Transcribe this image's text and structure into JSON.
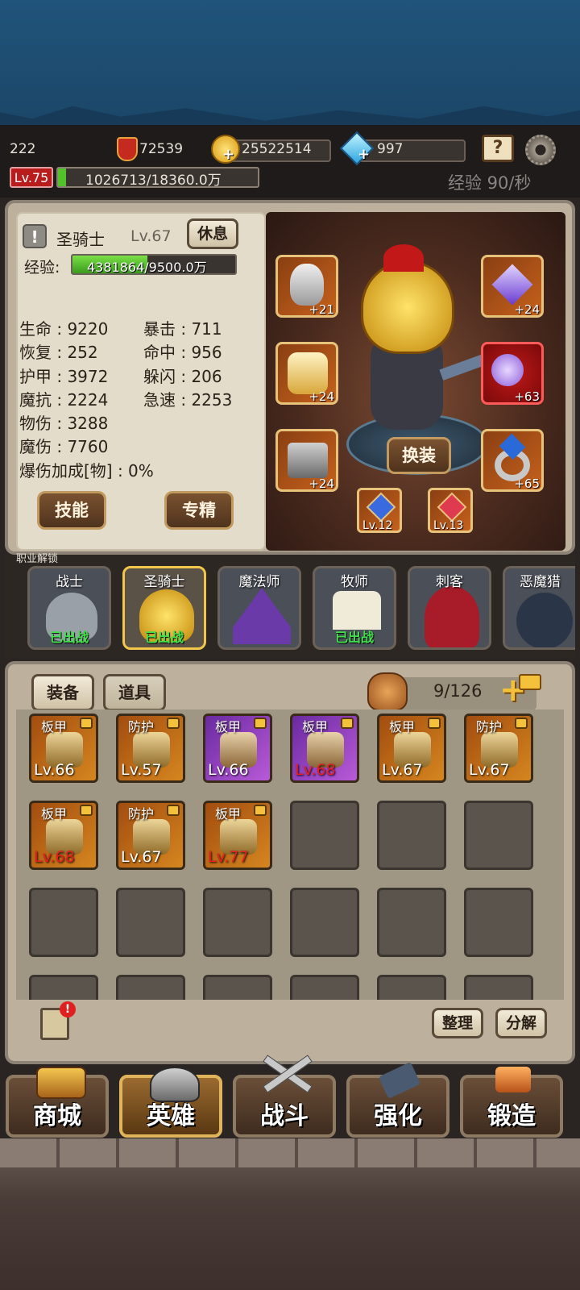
{
  "hud": {
    "player_id": "222",
    "power": "72539",
    "gold": "25522514",
    "gems": "997",
    "level": "Lv.75",
    "exp_bar": "1026713/18360.0万",
    "exp_rate": "经验 90/秒"
  },
  "hero": {
    "class_name": "圣骑士",
    "level": "Lv.67",
    "rest_label": "休息",
    "exp_label": "经验:",
    "exp_value": "4381864/9500.0万",
    "exp_fraction": 0.46,
    "stats_left": [
      "生命 : 9220",
      "恢复 : 252",
      "护甲 : 3972",
      "魔抗 : 2224",
      "物伤 : 3288",
      "魔伤 : 7760",
      "爆伤加成[物] : 0%"
    ],
    "stats_right": [
      "暴击 : 711",
      "命中 : 956",
      "躲闪 : 206",
      "急速 : 2253"
    ],
    "skills_label": "技能",
    "specialize_label": "专精",
    "change_label": "换装",
    "slots": {
      "helmet": "+21",
      "weapon_amulet": "+24",
      "armor": "+24",
      "weapon": "+63",
      "boots": "+24",
      "ring": "+65",
      "gem1": "Lv.12",
      "gem2": "Lv.13"
    }
  },
  "classes": {
    "header": "职业解锁",
    "items": [
      {
        "name": "战士",
        "status": "已出战"
      },
      {
        "name": "圣骑士",
        "status": "已出战"
      },
      {
        "name": "魔法师",
        "status": ""
      },
      {
        "name": "牧师",
        "status": "已出战"
      },
      {
        "name": "刺客",
        "status": ""
      },
      {
        "name": "恶魔猎",
        "status": ""
      }
    ]
  },
  "inventory": {
    "tab_equip": "装备",
    "tab_items": "道具",
    "capacity": "9/126",
    "sort_label": "整理",
    "decompose_label": "分解",
    "items": [
      {
        "tag": "板甲",
        "level": "Lv.66",
        "rarity": "gold",
        "red": false
      },
      {
        "tag": "防护",
        "level": "Lv.57",
        "rarity": "gold",
        "red": false
      },
      {
        "tag": "板甲",
        "level": "Lv.66",
        "rarity": "purple",
        "red": false
      },
      {
        "tag": "板甲",
        "level": "Lv.68",
        "rarity": "purple",
        "red": true
      },
      {
        "tag": "板甲",
        "level": "Lv.67",
        "rarity": "gold",
        "red": false
      },
      {
        "tag": "防护",
        "level": "Lv.67",
        "rarity": "gold",
        "red": false
      },
      {
        "tag": "板甲",
        "level": "Lv.68",
        "rarity": "gold",
        "red": true
      },
      {
        "tag": "防护",
        "level": "Lv.67",
        "rarity": "gold",
        "red": false
      },
      {
        "tag": "板甲",
        "level": "Lv.77",
        "rarity": "gold",
        "red": true
      }
    ]
  },
  "nav": {
    "shop": "商城",
    "hero": "英雄",
    "battle": "战斗",
    "enhance": "强化",
    "forge": "锻造"
  }
}
